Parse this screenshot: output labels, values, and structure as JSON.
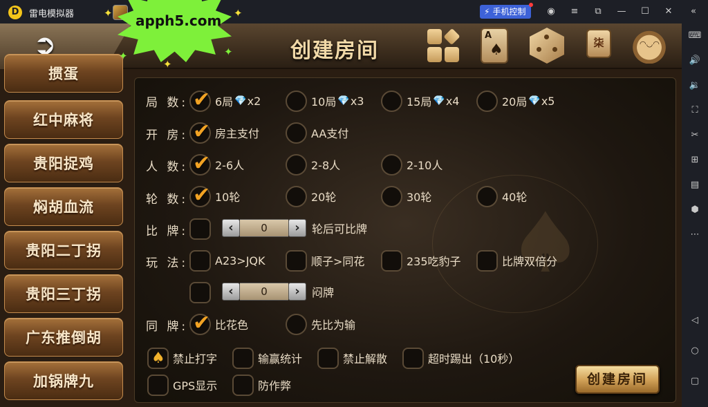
{
  "window": {
    "title": "雷电模拟器",
    "control_label": "手机控制"
  },
  "promo": {
    "text": "apph5.com"
  },
  "header": {
    "title": "创建房间",
    "tile_char": "柒"
  },
  "games": [
    "掼蛋",
    "红中麻将",
    "贵阳捉鸡",
    "焖胡血流",
    "贵阳二丁拐",
    "贵阳三丁拐",
    "广东推倒胡",
    "加锅牌九"
  ],
  "form": {
    "rounds": {
      "label": "局 数:",
      "options": [
        "6局",
        "10局",
        "15局",
        "20局"
      ],
      "costs": [
        "x2",
        "x3",
        "x4",
        "x5"
      ],
      "selected": 0
    },
    "pay": {
      "label": "开 房:",
      "options": [
        "房主支付",
        "AA支付"
      ],
      "selected": 0
    },
    "players": {
      "label": "人 数:",
      "options": [
        "2-6人",
        "2-8人",
        "2-10人"
      ],
      "selected": 0
    },
    "turns": {
      "label": "轮 数:",
      "options": [
        "10轮",
        "20轮",
        "30轮",
        "40轮"
      ],
      "selected": 0
    },
    "compare": {
      "label": "比 牌:",
      "value": "0",
      "suffix": "轮后可比牌"
    },
    "rules": {
      "label": "玩 法:",
      "options": [
        "A23>JQK",
        "顺子>同花",
        "235吃豹子",
        "比牌双倍分"
      ]
    },
    "stuffy": {
      "value": "0",
      "suffix": "闷牌"
    },
    "tie": {
      "label": "同 牌:",
      "options": [
        "比花色",
        "先比为输"
      ],
      "selected": 0
    },
    "extras": [
      "禁止打字",
      "输赢统计",
      "禁止解散",
      "超时踢出（10秒）",
      "GPS显示",
      "防作弊"
    ]
  },
  "create_button": "创建房间",
  "colors": {
    "accent": "#f1a223",
    "gem": "#55c7f4",
    "control": "#3d62d8"
  }
}
